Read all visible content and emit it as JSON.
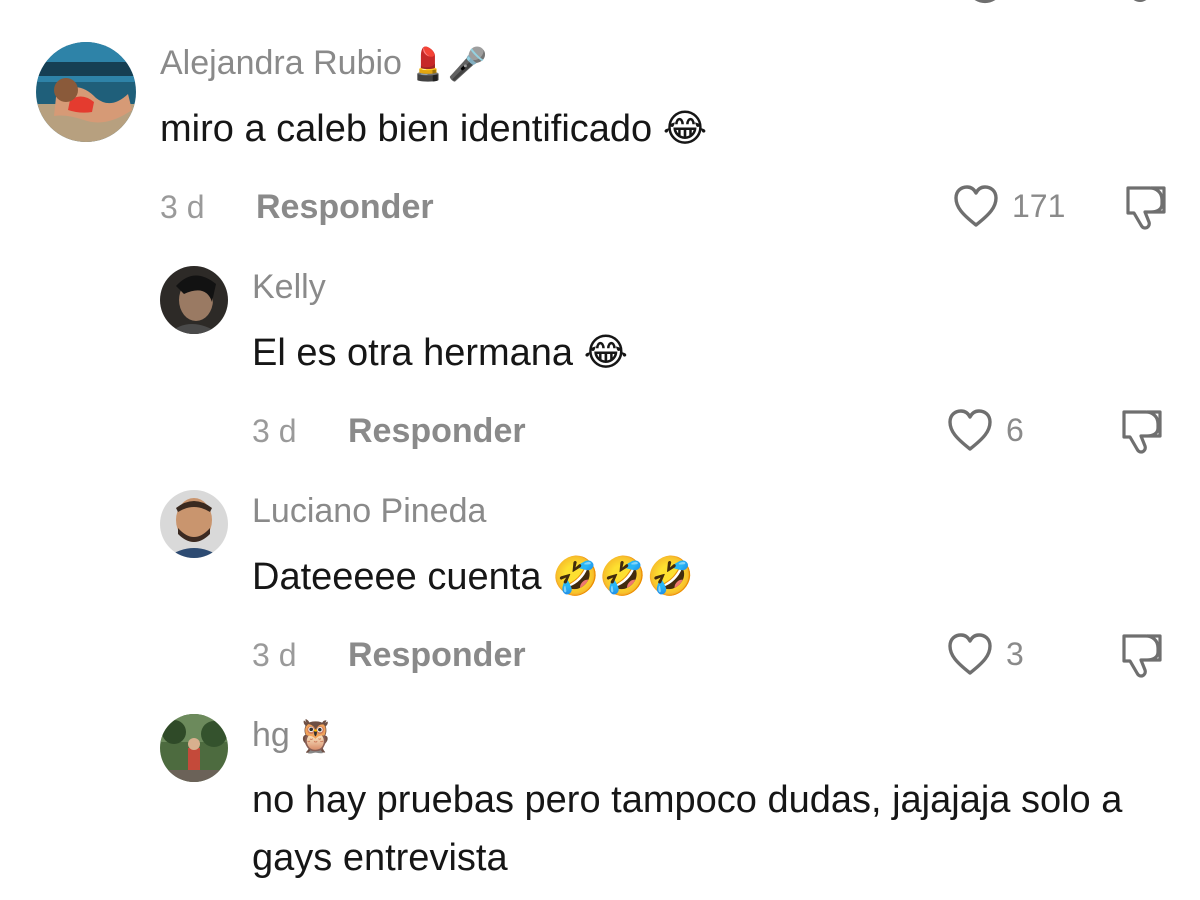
{
  "comments": [
    {
      "username": "Alejandra Rubio",
      "badges": "💄🎤",
      "text": "miro a caleb bien identificado",
      "emoji": "😂",
      "age": "3 d",
      "reply_label": "Responder",
      "likes": "171"
    },
    {
      "username": "Kelly",
      "badges": "",
      "text": "El es otra hermana",
      "emoji": "😂",
      "age": "3 d",
      "reply_label": "Responder",
      "likes": "6"
    },
    {
      "username": "Luciano Pineda",
      "badges": "",
      "text": "Dateeeee cuenta",
      "emoji": "🤣🤣🤣",
      "age": "3 d",
      "reply_label": "Responder",
      "likes": "3"
    },
    {
      "username": "hg",
      "badges": "🦉",
      "text": "no hay pruebas pero tampoco dudas, jajajaja solo a gays entrevista",
      "emoji": ""
    }
  ],
  "icons": {
    "like": "heart-outline-icon",
    "dislike": "thumbs-down-outline-icon"
  },
  "colors": {
    "username": "#8a8a8a",
    "text": "#161616",
    "meta": "#9a9a9a",
    "icon_stroke": "#6f6f6f"
  }
}
